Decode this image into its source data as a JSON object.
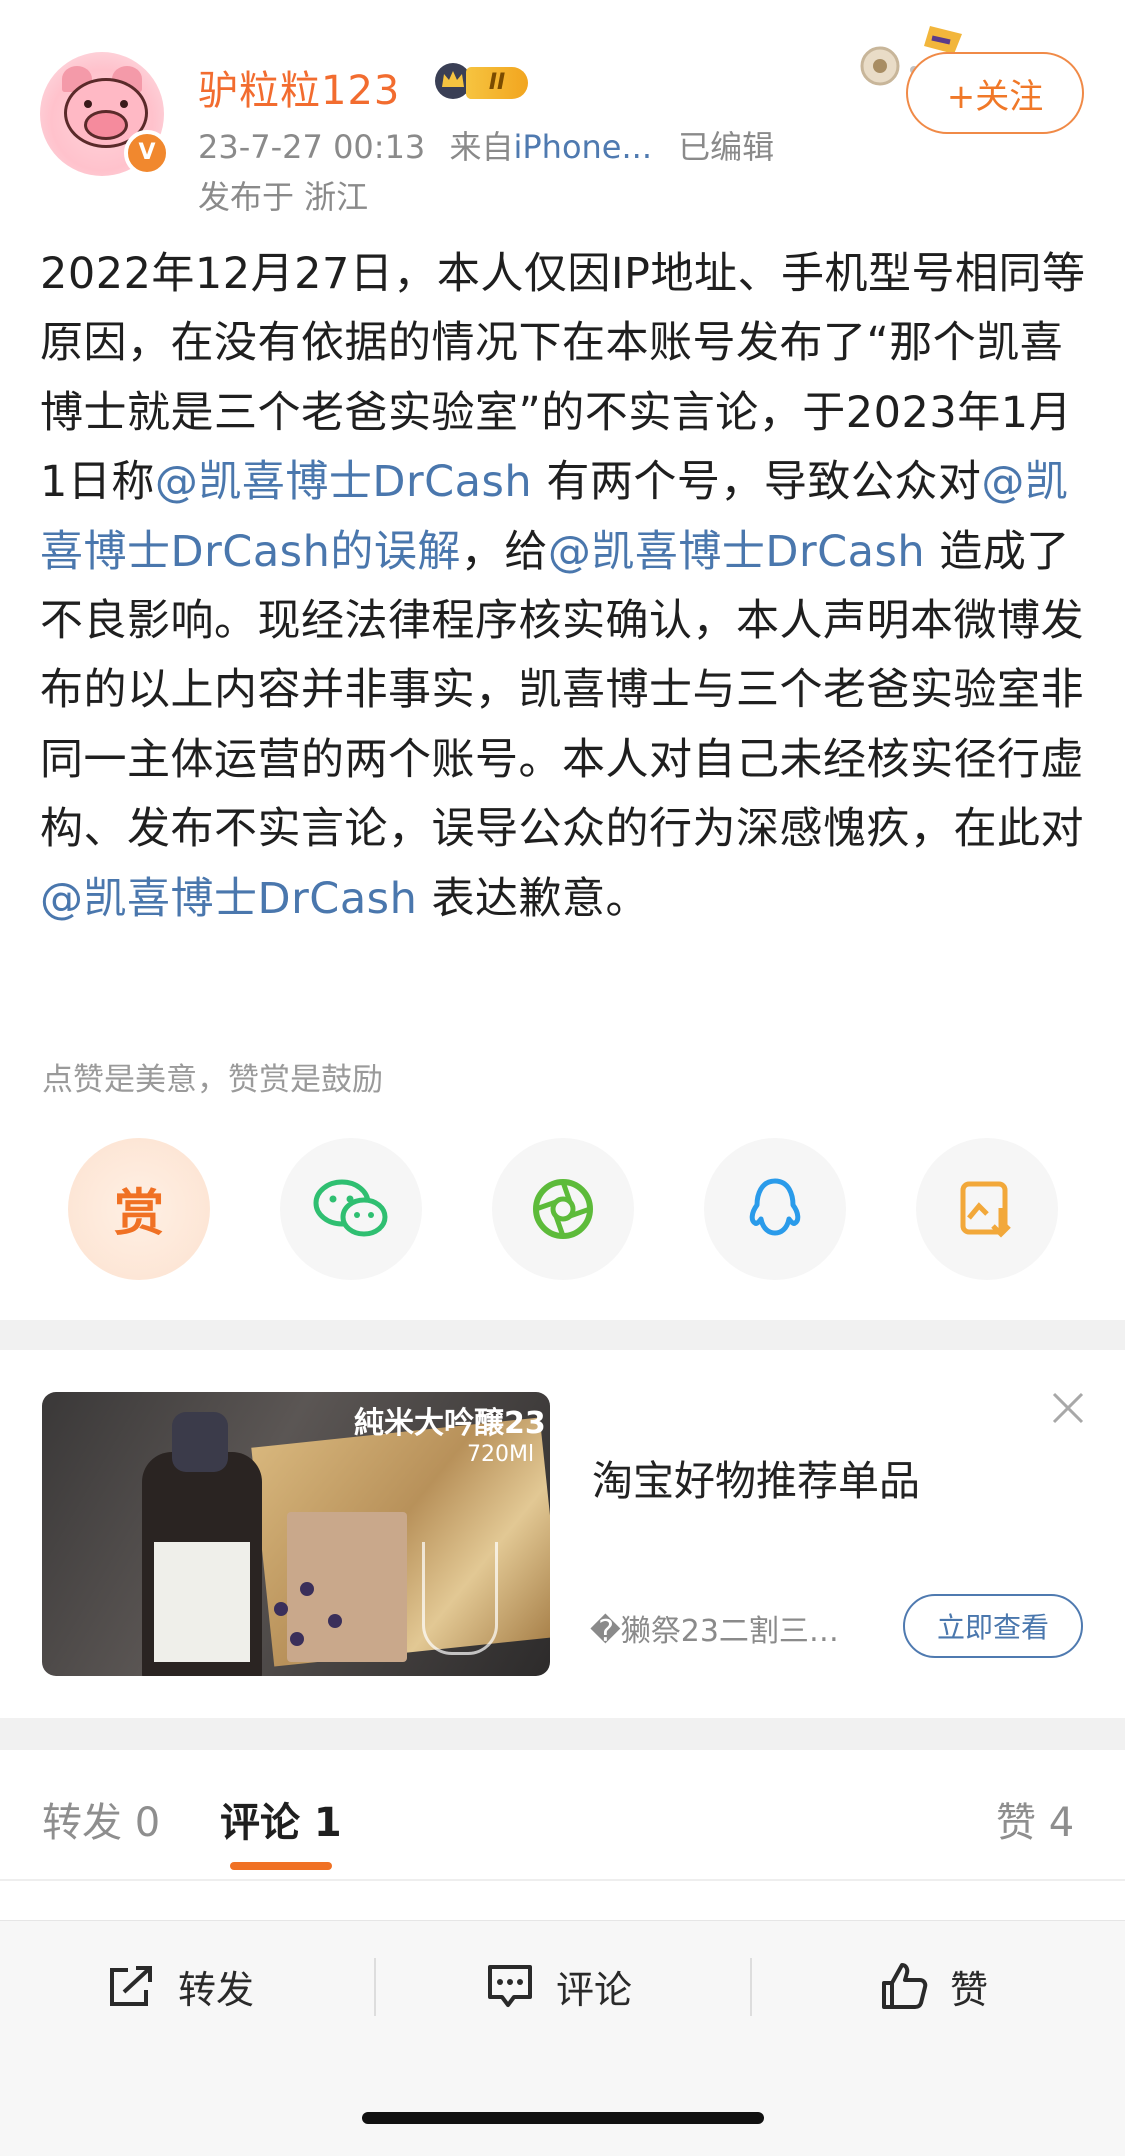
{
  "post": {
    "username": "驴粒粒123",
    "level": "II",
    "verified_mark": "V",
    "timestamp": "23-7-27 00:13",
    "source_prefix": "来自",
    "source": "iPhone...",
    "edited": "已编辑",
    "location": "发布于 浙江",
    "follow_label": "+关注",
    "body": {
      "t1": "2022年12月27日，本人仅因IP地址、手机型号相同等原因，在没有依据的情况下在本账号发布了“那个凯喜博士就是三个老爸实验室”的不实言论，于2023年1月1日称",
      "m1": "@凯喜博士DrCash",
      "t2": "有两个号，导致公众对",
      "m2": "@凯喜博士DrCash的误解",
      "t3": "，给",
      "m3": "@凯喜博士DrCash",
      "t4": "造成了不良影响。现经法律程序核实确认，本人声明本微博发布的以上内容并非事实，凯喜博士与三个老爸实验室非同一主体运营的两个账号。本人对自己未经核实径行虚构、发布不实言论，误导公众的行为深感愧疚，在此对",
      "m4": "@凯喜博士DrCash",
      "t5": "表达歉意。"
    },
    "tip_line": "点赞是美意，赞赏是鼓励"
  },
  "share": {
    "reward_label": "赏",
    "icons": [
      "reward-icon",
      "wechat-icon",
      "moments-icon",
      "qq-icon",
      "save-image-icon"
    ]
  },
  "ad": {
    "title": "淘宝好物推荐单品",
    "subtitle": "�獭祭23二割三…",
    "button": "立即查看",
    "image_text": "純米大吟醸23",
    "image_volume": "720Ml"
  },
  "tabs": {
    "repost": "转发 0",
    "comment": "评论 1",
    "like": "赞 4"
  },
  "actions": {
    "repost": "转发",
    "comment": "评论",
    "like": "赞"
  },
  "colors": {
    "accent": "#f07124",
    "link": "#4a77ad",
    "username": "#f26c2f"
  }
}
